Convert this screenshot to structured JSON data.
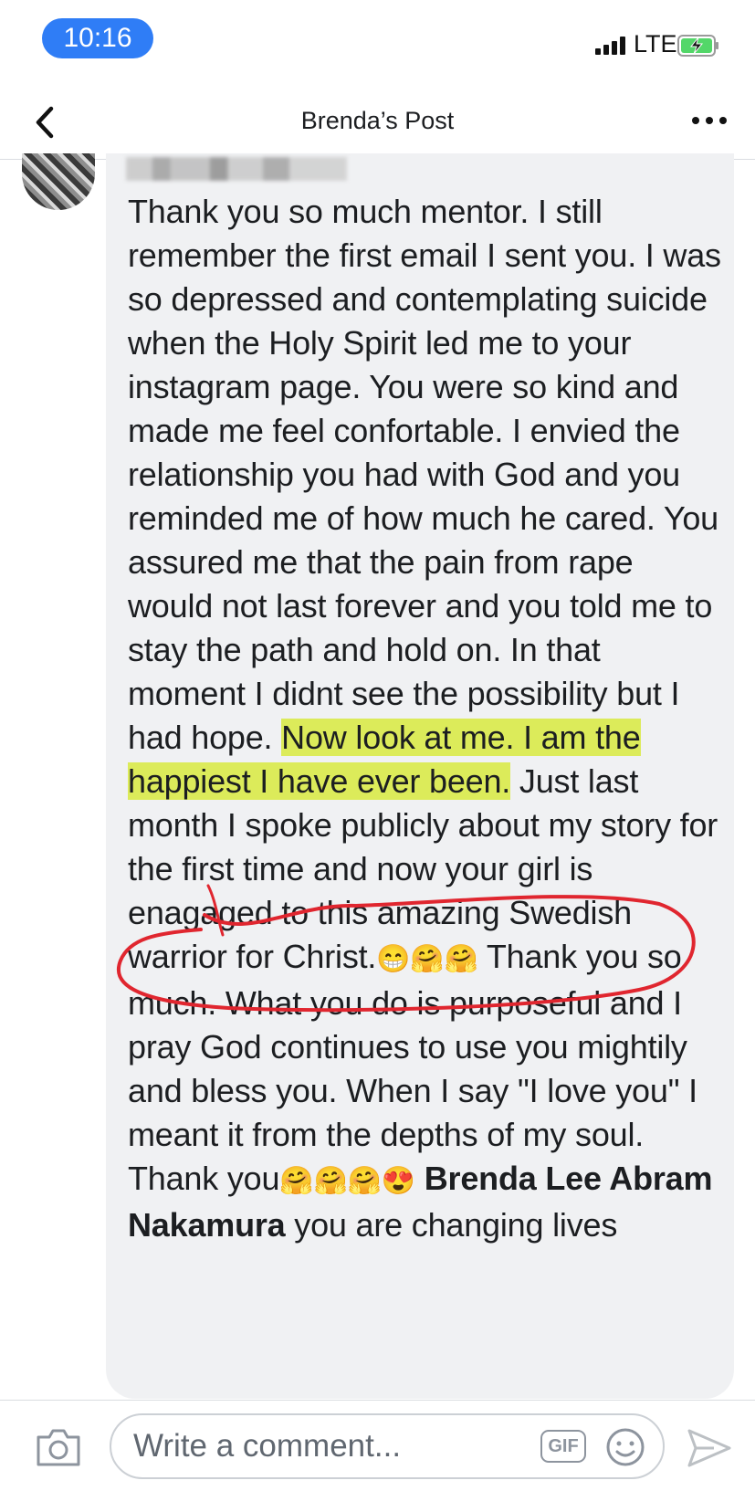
{
  "status_bar": {
    "time": "10:16",
    "network": "LTE"
  },
  "nav": {
    "title": "Brenda’s Post"
  },
  "comment": {
    "body": [
      {
        "text": "Thank you so much mentor. I still remember the first email I sent you. I was so depressed and contemplating suicide when the Holy Spirit led me to your instagram page. You were so kind and made me feel confortable. I envied the relationship you had with God and you reminded me of how much he cared. You assured me that the pain from rape would not last forever and you told me to stay the path and hold on. In that moment I didnt see the possibility but I had hope. "
      },
      {
        "text": "Now look at me. I am the happiest I have ever been."
      },
      {
        "text": " Just last month I spoke publicly about my story for the first time and now your girl is enagaged to this amazing Swedish warrior for Christ."
      },
      {
        "text": "😁🤗🤗"
      },
      {
        "text": " Thank you so much. What you do is purposeful and I pray God continues to use you mightily and bless you. When I say \"I love you\" I meant it from the depths of my soul. Thank you"
      },
      {
        "text": "🤗🤗🤗😍"
      },
      {
        "text": " Brenda Lee Abram Nakamura"
      },
      {
        "text": " you are changing lives"
      }
    ],
    "highlight_color": "#dceb5a",
    "annotation_color": "#e0262f"
  },
  "composer": {
    "placeholder": "Write a comment...",
    "gif_label": "GIF"
  },
  "icons": {
    "back": "chevron-left-icon",
    "more": "more-horizontal-icon",
    "camera": "camera-icon",
    "emoji": "smiley-icon",
    "send": "send-icon",
    "battery": "battery-charging-icon",
    "signal": "signal-bars-icon"
  },
  "colors": {
    "accent": "#2f7df6",
    "bubble": "#f0f1f3"
  }
}
